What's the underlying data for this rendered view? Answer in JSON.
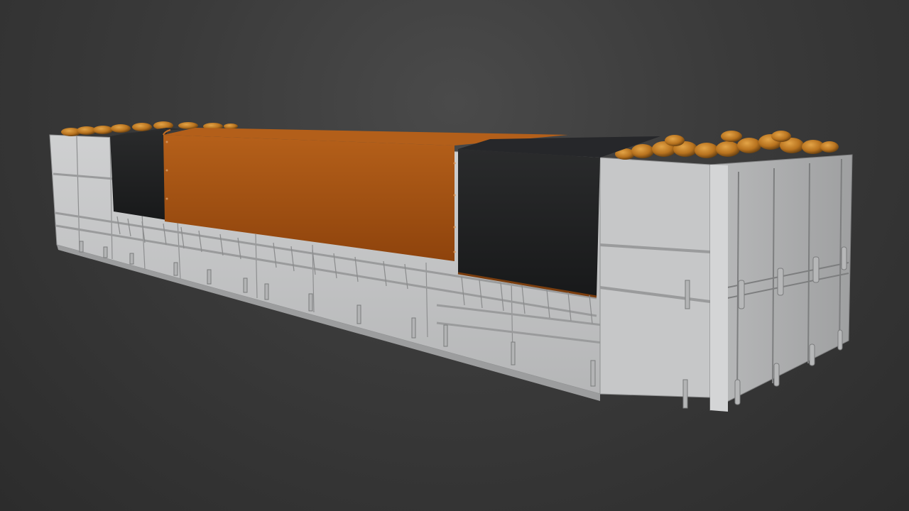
{
  "viewport": {
    "background_color_top": "#4a4a4a",
    "background_color_bottom": "#2c2c2c"
  },
  "model": {
    "subject": "trailer-body",
    "panel_color": "#c9cacb",
    "panel_shadow_color": "#a9aaab",
    "cargo_color": "#b8731f",
    "tarp_black_color": "#1f2021",
    "tarp_orange_color": "#a9520f"
  },
  "footer": {
    "caption": ""
  }
}
